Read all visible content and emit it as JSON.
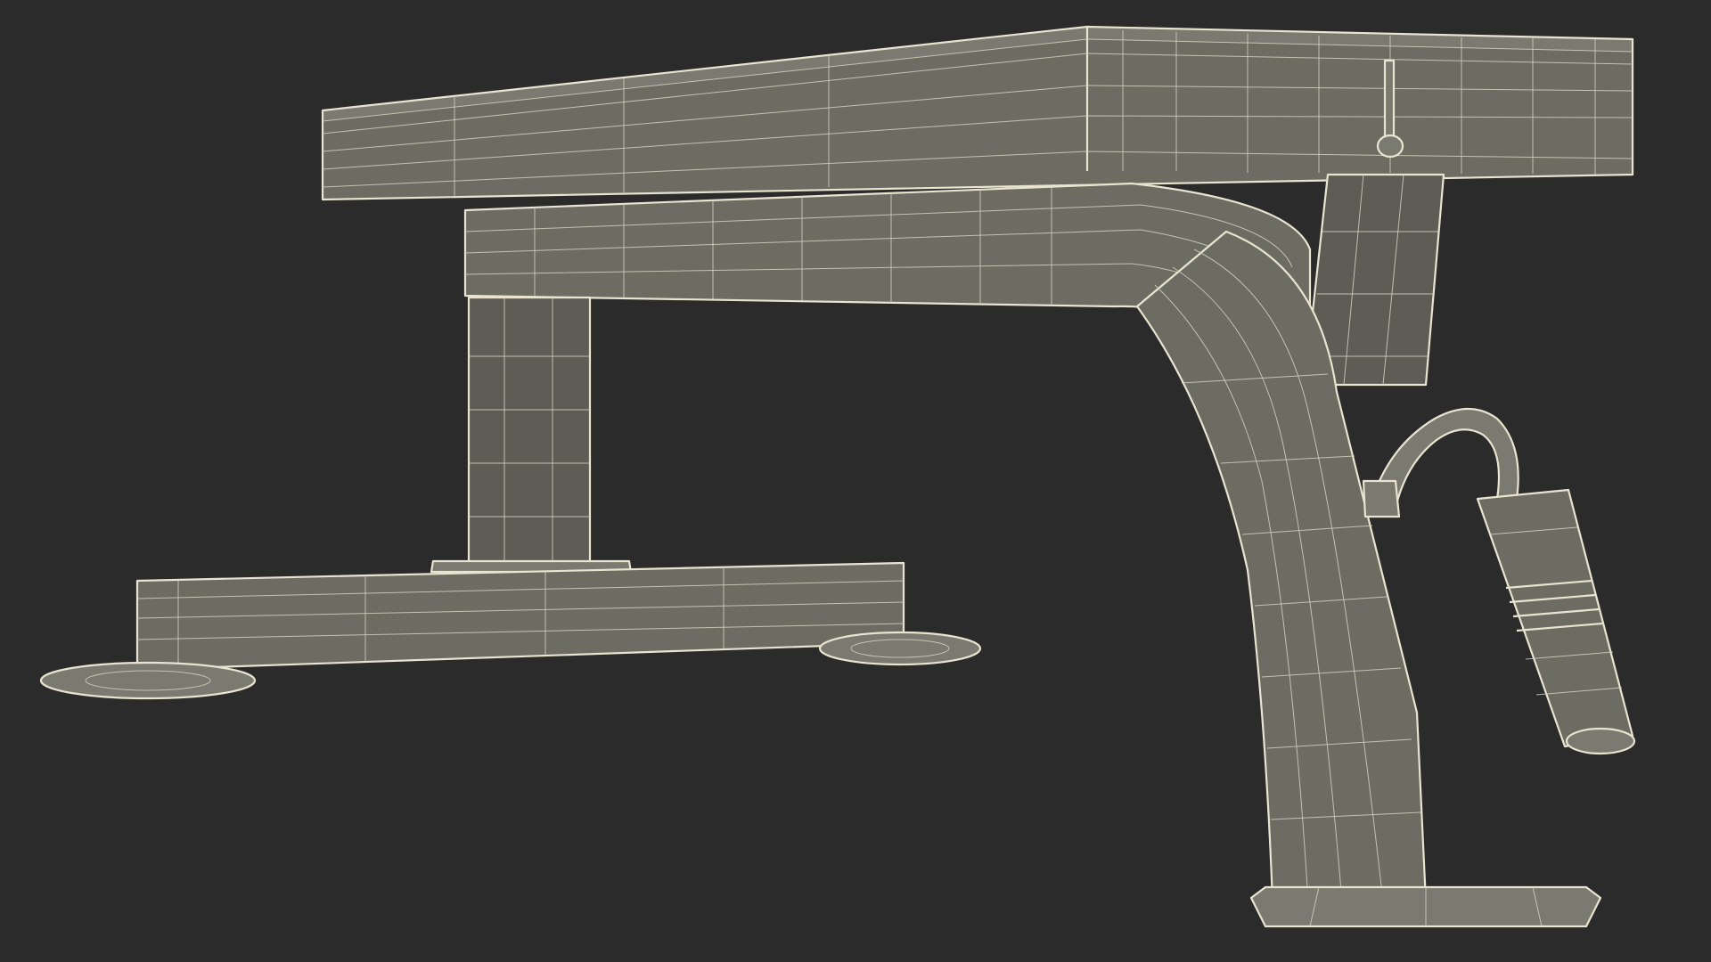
{
  "scene": {
    "background": "#2b2b2b",
    "mesh_fill": "#6c6c63",
    "wire_color": "#e8e4cf"
  }
}
